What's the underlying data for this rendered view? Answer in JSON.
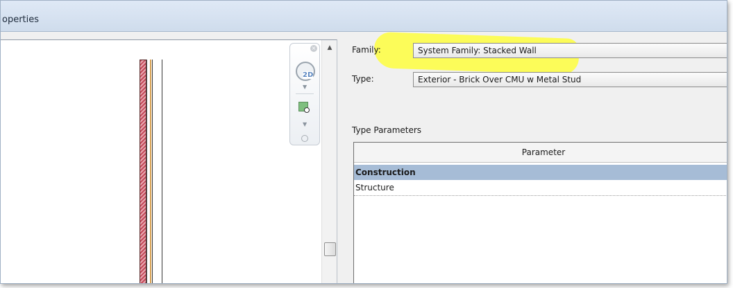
{
  "window": {
    "title": "operties"
  },
  "preview": {
    "navbar": {
      "wheel_badge": "2D",
      "close_glyph": "×"
    },
    "scroll_up_glyph": "▲"
  },
  "form": {
    "family_label": "Family:",
    "family_value": "System Family: Stacked Wall",
    "type_label": "Type:",
    "type_value": "Exterior - Brick Over CMU w Metal Stud"
  },
  "type_parameters": {
    "title": "Type Parameters",
    "column_header": "Parameter",
    "rows": [
      {
        "label": "Construction",
        "kind": "group-header"
      },
      {
        "label": "Structure",
        "kind": "parameter"
      }
    ]
  },
  "colors": {
    "highlight": "#ffff33",
    "group_row": "#a6bcd6",
    "brick": "#c44a5a"
  }
}
